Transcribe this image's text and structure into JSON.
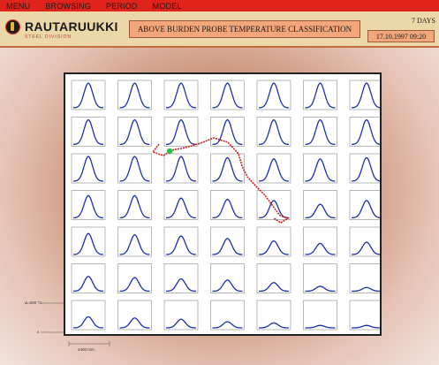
{
  "menu": {
    "items": [
      {
        "label": "MENU"
      },
      {
        "label": "BROWSING"
      },
      {
        "label": "PERIOD"
      },
      {
        "label": "MODEL"
      }
    ]
  },
  "header": {
    "logo_text": "RAUTARUUKKI",
    "logo_subtext": "STEEL DIVISION",
    "title": "ABOVE BURDEN PROBE TEMPERATURE CLASSIFICATION",
    "period": "7 DAYS",
    "datetime": "17.10.1997 09:20"
  },
  "axis": {
    "temp_label": "Δ=600 °C",
    "x_label": "x",
    "scale_label": "4400 mm"
  },
  "grid": {
    "rows": 7,
    "cols": 7,
    "peak_levels": [
      [
        1.0,
        1.0,
        1.0,
        1.0,
        1.0,
        1.0,
        1.0
      ],
      [
        1.0,
        1.0,
        1.0,
        1.0,
        1.0,
        1.0,
        1.0
      ],
      [
        1.0,
        1.0,
        1.0,
        0.95,
        0.9,
        0.9,
        0.95
      ],
      [
        0.9,
        0.9,
        0.8,
        0.75,
        0.7,
        0.55,
        0.7
      ],
      [
        0.85,
        0.8,
        0.75,
        0.65,
        0.55,
        0.45,
        0.5
      ],
      [
        0.6,
        0.55,
        0.5,
        0.45,
        0.35,
        0.2,
        0.15
      ],
      [
        0.45,
        0.4,
        0.35,
        0.25,
        0.2,
        0.1,
        0.1
      ]
    ],
    "marker_color": "#22c24a",
    "trajectory_color": "#c9201c",
    "curve_color": "#1a2fb0"
  }
}
